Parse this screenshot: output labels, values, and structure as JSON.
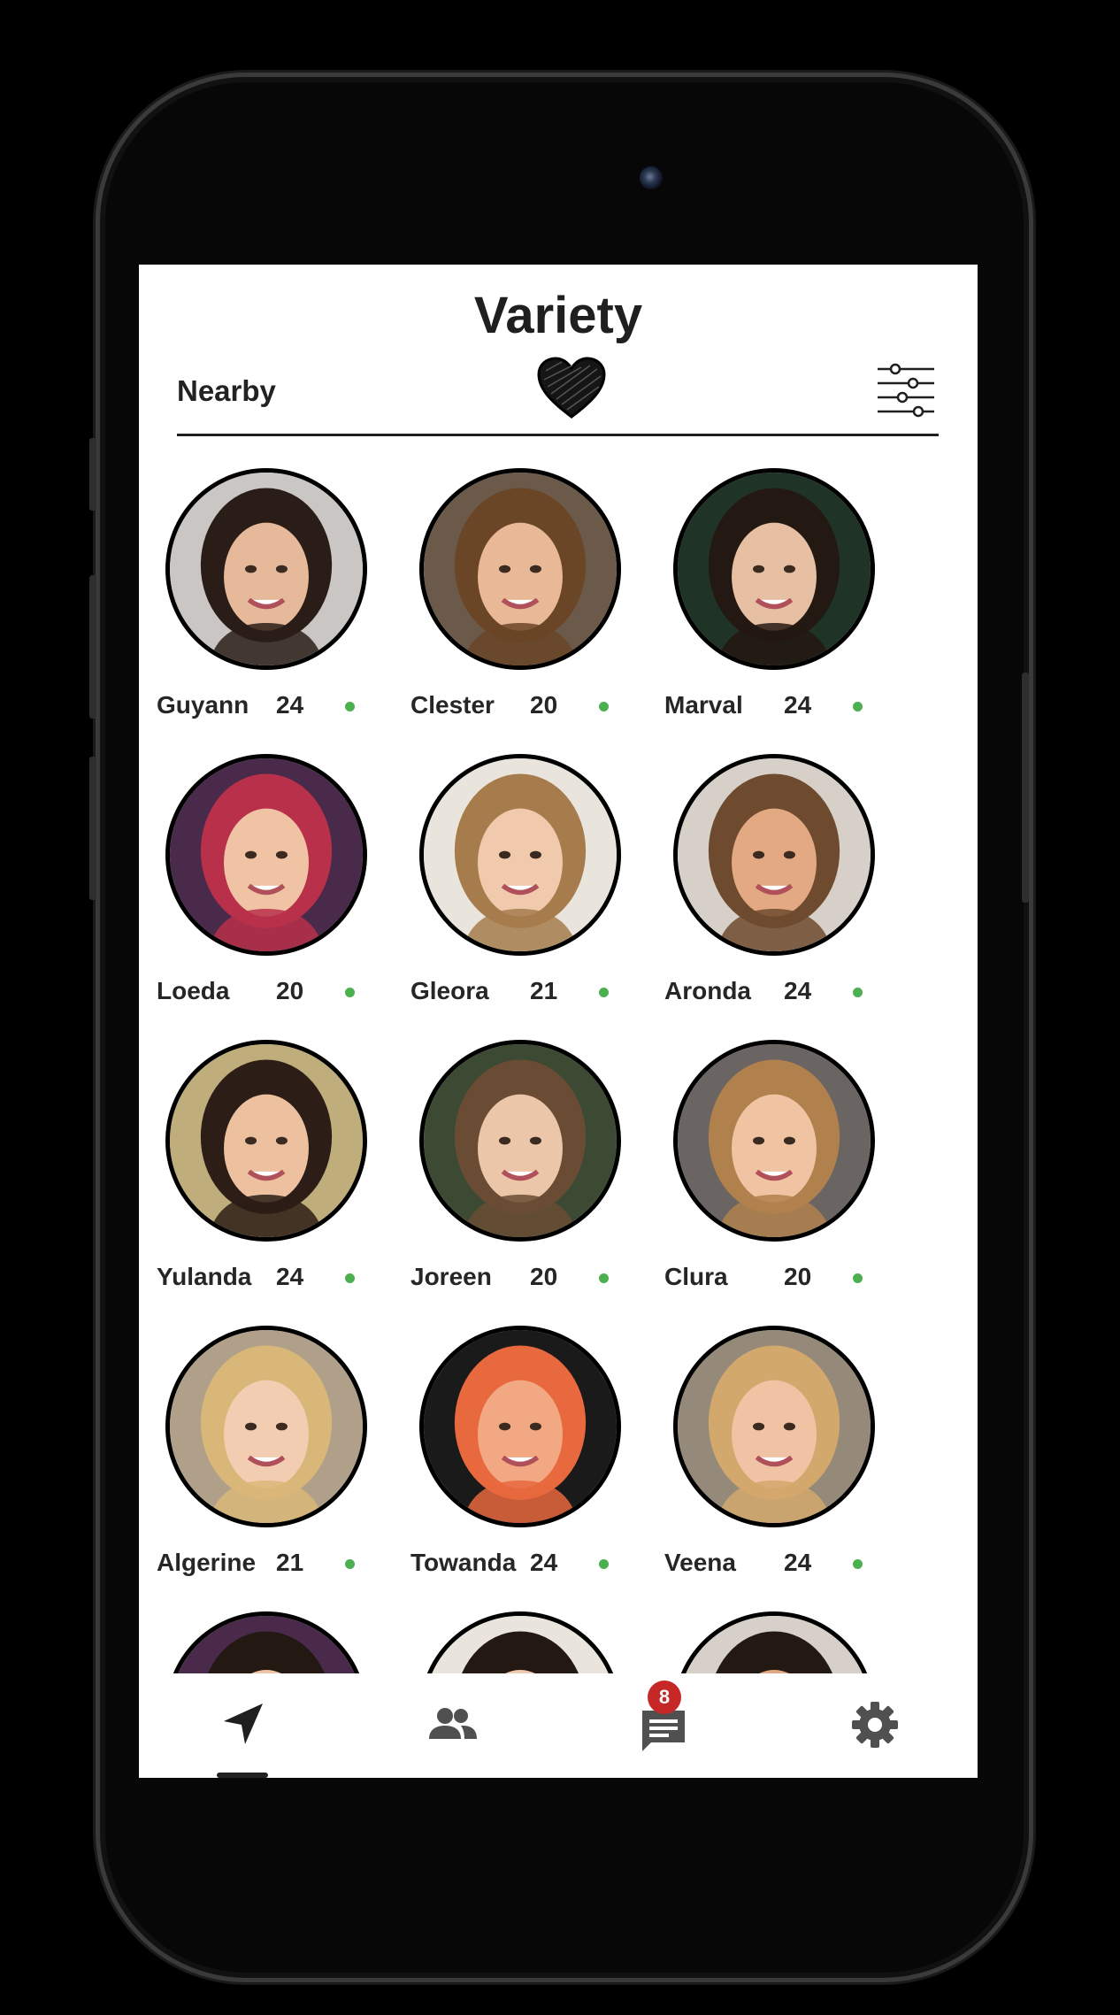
{
  "app": {
    "title": "Variety",
    "tab_label": "Nearby"
  },
  "icons": {
    "heart": "heart-icon",
    "filter": "sliders-icon",
    "nav_nearby": "navigation-arrow-icon",
    "nav_people": "people-icon",
    "nav_messages": "chat-icon",
    "nav_settings": "gear-icon"
  },
  "colors": {
    "online": "#4caf50",
    "badge": "#c62828"
  },
  "profiles": [
    {
      "name": "Guyann",
      "age": "24"
    },
    {
      "name": "Clester",
      "age": "20"
    },
    {
      "name": "Marval",
      "age": "24"
    },
    {
      "name": "Loeda",
      "age": "20"
    },
    {
      "name": "Gleora",
      "age": "21"
    },
    {
      "name": "Aronda",
      "age": "24"
    },
    {
      "name": "Yulanda",
      "age": "24"
    },
    {
      "name": "Joreen",
      "age": "20"
    },
    {
      "name": "Clura",
      "age": "20"
    },
    {
      "name": "Algerine",
      "age": "21"
    },
    {
      "name": "Towanda",
      "age": "24"
    },
    {
      "name": "Veena",
      "age": "24"
    }
  ],
  "nav": {
    "messages_badge": "8"
  }
}
